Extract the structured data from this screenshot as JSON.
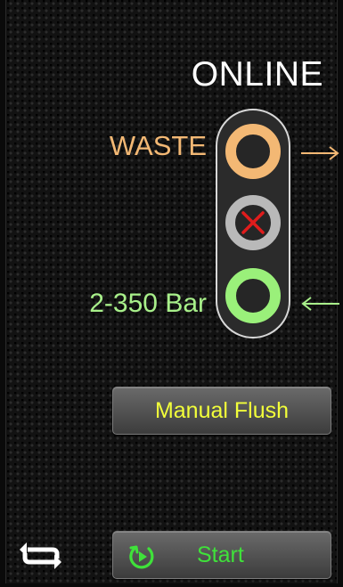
{
  "status": {
    "label": "ONLINE"
  },
  "valve": {
    "waste_label": "WASTE",
    "pressure_label": "2-350 Bar",
    "ports": [
      {
        "name": "waste",
        "color": "#f3b874",
        "state": "open"
      },
      {
        "name": "blocked",
        "color": "#b9b9b9",
        "state": "blocked",
        "mark_color": "#e01c1c"
      },
      {
        "name": "pressure",
        "color": "#9af07a",
        "state": "open"
      }
    ],
    "flow_out_icon": "arrow-right-icon",
    "flow_in_icon": "arrow-left-icon"
  },
  "buttons": {
    "manual_flush": "Manual Flush",
    "start": "Start",
    "start_icon": "play-cycle-icon",
    "repeat_icon": "repeat-icon"
  },
  "colors": {
    "waste": "#f3b874",
    "pressure": "#a8f08a",
    "flush_text": "#f2ff3a",
    "start_text": "#3fe23a",
    "blocked_x": "#e01c1c"
  }
}
